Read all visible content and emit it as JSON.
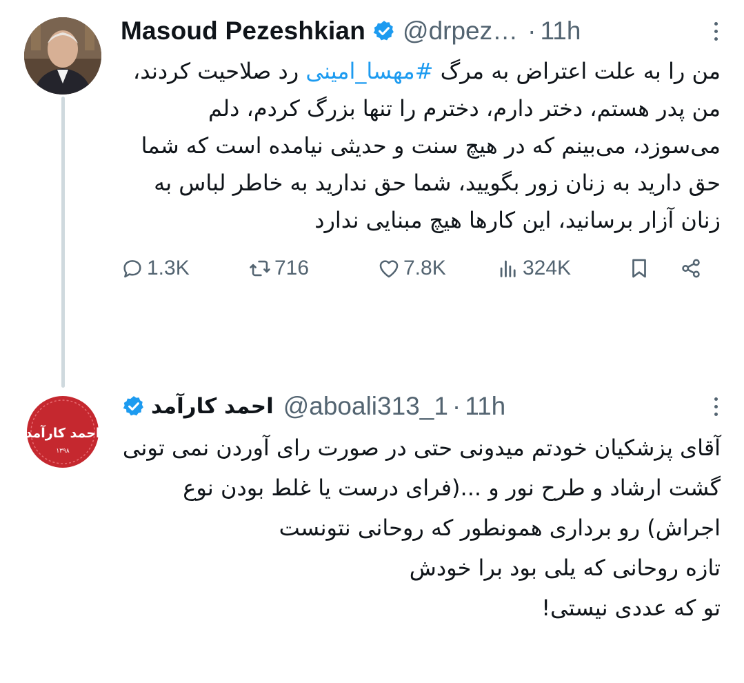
{
  "tweets": [
    {
      "name": "Masoud Pezeshkian",
      "handle": "@drpez…",
      "separator": "·",
      "time": "11h",
      "text_before": "من را به علت اعتراض به مرگ ",
      "hashtag": "#مهسا_امینی",
      "text_after": " رد صلاحیت کردند، من پدر هستم، دختر دارم، دخترم را تنها بزرگ کردم، دلم می‌سوزد، می‌بینم که در هیچ سنت و حدیثی نیامده است که شما حق دارید به زنان زور بگویید، شما حق ندارید به خاطر لباس به زنان آزار برسانید، این کارها هیچ مبنایی ندارد",
      "stats": {
        "replies": "1.3K",
        "retweets": "716",
        "likes": "7.8K",
        "views": "324K"
      }
    },
    {
      "name": "احمد کارآمد",
      "handle": "@aboali313_1",
      "separator": "·",
      "time": "11h",
      "text": "آقای پزشکیان خودتم میدونی حتی در صورت رای آوردن نمی تونی گشت ارشاد و طرح نور و ...(فرای درست یا غلط بودن نوع اجراش) رو برداری همونطور که روحانی نتونست\nتازه روحانی که یلی بود برا خودش\nتو که عددی نیستی!"
    }
  ],
  "avatar2_text": "احمد کارآمد",
  "colors": {
    "accent": "#1d9bf0",
    "muted": "#536471",
    "thread_line": "#cfd9de",
    "avatar2_red": "#c5282f"
  },
  "icons": [
    "reply-icon",
    "retweet-icon",
    "like-icon",
    "views-icon",
    "bookmark-icon",
    "share-icon",
    "verified-badge-icon",
    "more-options-icon"
  ]
}
